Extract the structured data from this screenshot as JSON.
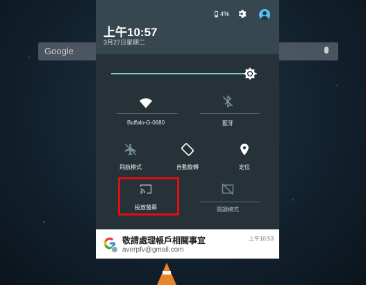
{
  "home": {
    "search_label": "Google"
  },
  "status": {
    "time": "上午10:57",
    "date": "3月27日星期二",
    "battery": "4%"
  },
  "brightness": {
    "level": 0.95
  },
  "tiles": [
    {
      "id": "wifi",
      "label": "Buffalo-G-0680",
      "icon": "wifi-icon",
      "active": true
    },
    {
      "id": "bluetooth",
      "label": "藍牙",
      "icon": "bluetooth-off-icon",
      "active": false
    },
    {
      "id": "airplane",
      "label": "飛航模式",
      "icon": "airplane-icon",
      "active": false
    },
    {
      "id": "rotate",
      "label": "自動旋轉",
      "icon": "screen-rotation-icon",
      "active": true
    },
    {
      "id": "location",
      "label": "定位",
      "icon": "location-pin-icon",
      "active": true
    },
    {
      "id": "cast",
      "label": "投放螢幕",
      "icon": "cast-icon",
      "active": false
    },
    {
      "id": "reading",
      "label": "閱讀模式",
      "icon": "reading-mode-icon",
      "active": false
    }
  ],
  "notification": {
    "title": "敬請處理帳戶相關事宜",
    "account": "averpfv@gmail.com",
    "time": "上午10:53"
  },
  "colors": {
    "shade_bg": "#263238",
    "header_bg": "#37474f",
    "accent": "#80cbc4",
    "highlight": "#e01010"
  }
}
